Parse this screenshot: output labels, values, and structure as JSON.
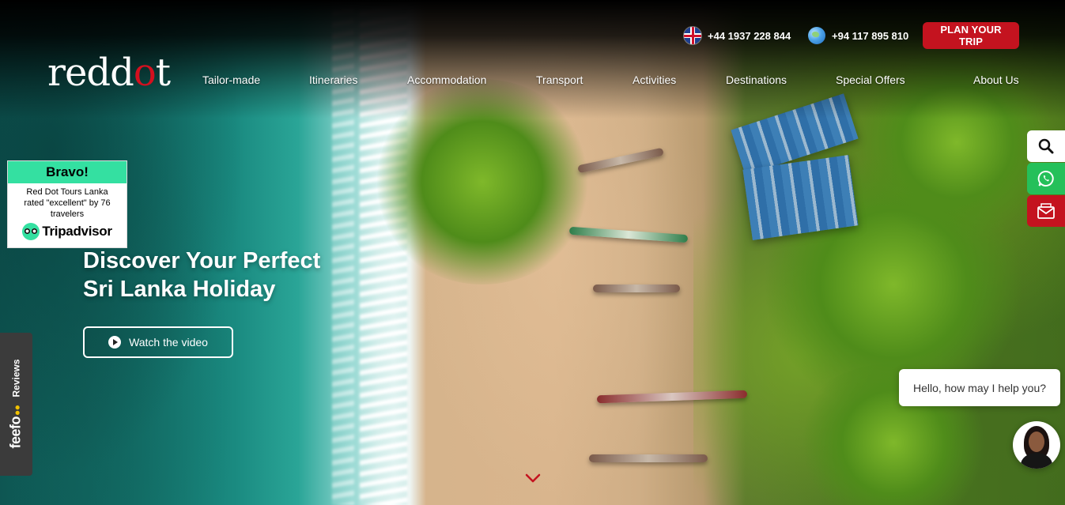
{
  "topbar": {
    "uk_phone": "+44 1937 228 844",
    "intl_phone": "+94 117 895 810",
    "plan_button": "PLAN YOUR TRIP"
  },
  "logo": {
    "part1": "redd",
    "dot": "o",
    "part2": "t"
  },
  "nav": {
    "items": [
      {
        "label": "Tailor-made"
      },
      {
        "label": "Itineraries"
      },
      {
        "label": "Accommodation"
      },
      {
        "label": "Transport"
      },
      {
        "label": "Activities"
      },
      {
        "label": "Destinations"
      },
      {
        "label": "Special Offers"
      },
      {
        "label": "About Us"
      }
    ]
  },
  "tripadvisor": {
    "heading": "Bravo!",
    "text": "Red Dot Tours Lanka rated \"excellent\" by 76 travelers",
    "brand": "Tripadvisor"
  },
  "hero": {
    "line1": "Discover Your Perfect",
    "line2": "Sri Lanka Holiday",
    "video_button": "Watch the video"
  },
  "feefo": {
    "brand": "feefo",
    "label": "Reviews"
  },
  "chat": {
    "message": "Hello, how may I help you?"
  },
  "icons": {
    "search": "search-icon",
    "whatsapp": "whatsapp-icon",
    "mail": "mail-icon",
    "scroll": "chevron-down-icon"
  },
  "colors": {
    "brand_red": "#c4131f",
    "tripadvisor_green": "#34e0a1",
    "whatsapp_green": "#25c05a",
    "feefo_dark": "#3b3b3b"
  }
}
